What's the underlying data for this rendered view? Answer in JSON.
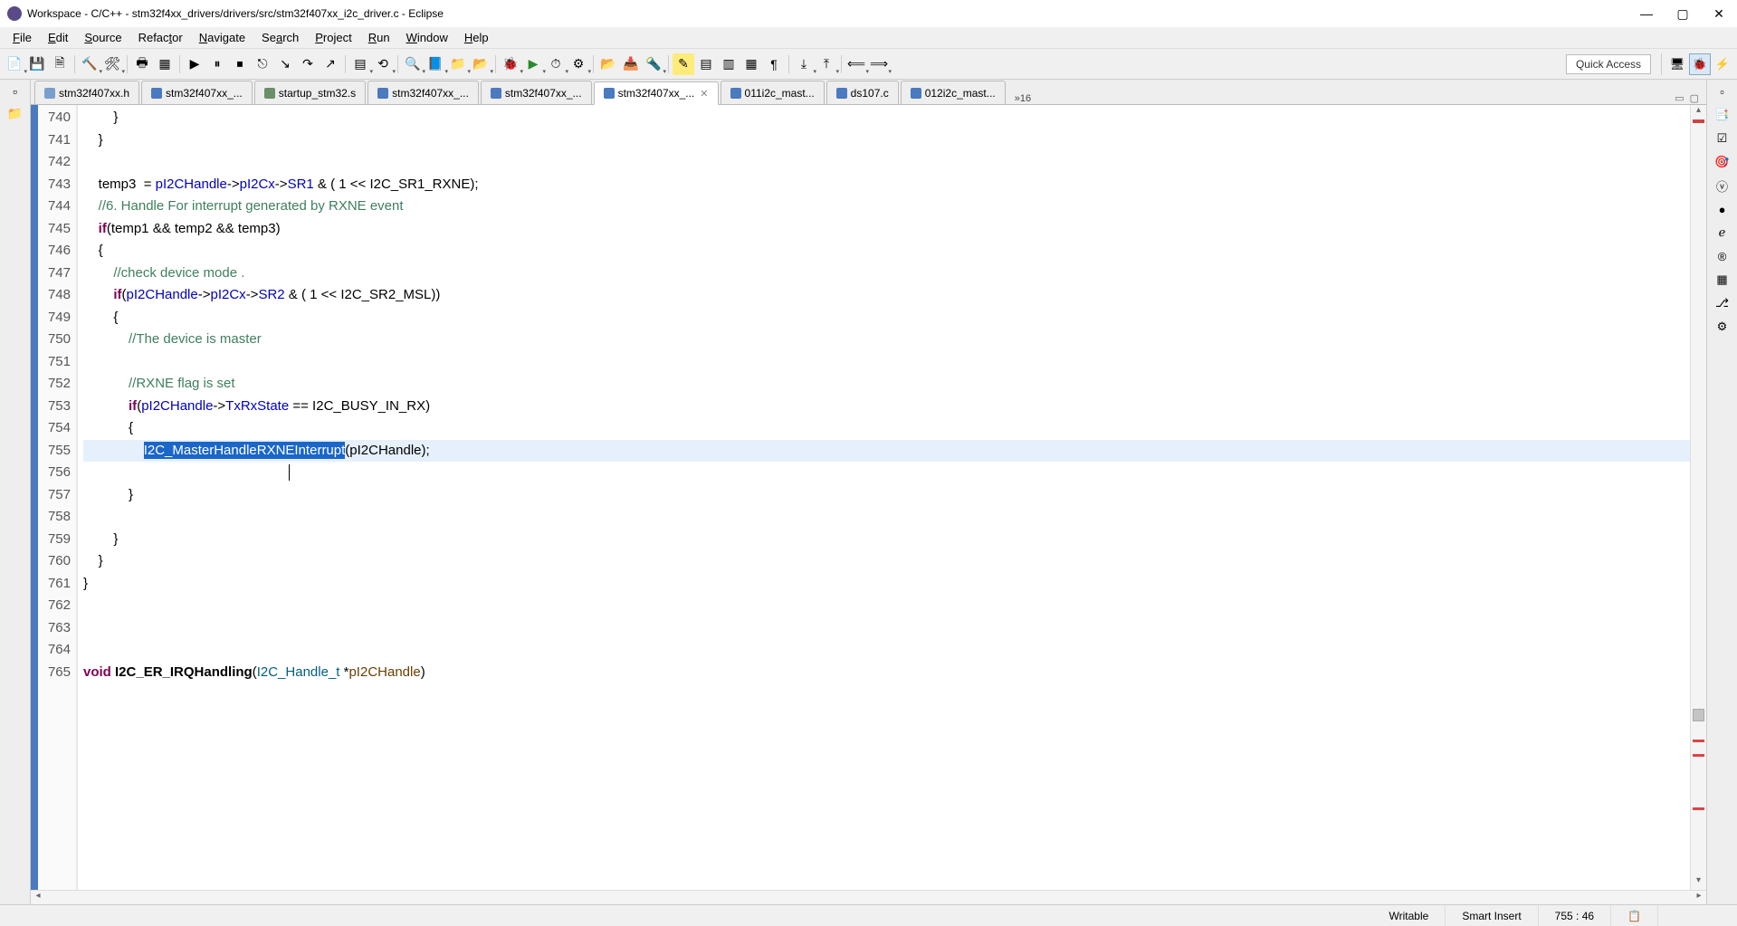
{
  "window": {
    "title": "Workspace - C/C++ - stm32f4xx_drivers/drivers/src/stm32f407xx_i2c_driver.c - Eclipse"
  },
  "menu": {
    "file": "File",
    "edit": "Edit",
    "source": "Source",
    "refactor": "Refactor",
    "navigate": "Navigate",
    "search": "Search",
    "project": "Project",
    "run": "Run",
    "window": "Window",
    "help": "Help"
  },
  "toolbar": {
    "quick_access": "Quick Access"
  },
  "tabs": {
    "items": [
      {
        "label": "stm32f407xx.h",
        "kind": "h"
      },
      {
        "label": "stm32f407xx_...",
        "kind": "c"
      },
      {
        "label": "startup_stm32.s",
        "kind": "s"
      },
      {
        "label": "stm32f407xx_...",
        "kind": "c"
      },
      {
        "label": "stm32f407xx_...",
        "kind": "c"
      },
      {
        "label": "stm32f407xx_...",
        "kind": "c",
        "active": true
      },
      {
        "label": "011i2c_mast...",
        "kind": "c"
      },
      {
        "label": "ds107.c",
        "kind": "c"
      },
      {
        "label": "012i2c_mast...",
        "kind": "c"
      }
    ],
    "overflow": "»16"
  },
  "status": {
    "writable": "Writable",
    "insert": "Smart Insert",
    "position": "755 : 46"
  },
  "code": {
    "first_line": 740,
    "lines": [
      {
        "n": 740,
        "html": "        }"
      },
      {
        "n": 741,
        "html": "    }"
      },
      {
        "n": 742,
        "html": ""
      },
      {
        "n": 743,
        "html": "    temp3  = <span class='field'>pI2CHandle</span>-&gt;<span class='str-const'>pI2Cx</span>-&gt;<span class='str-const'>SR1</span> &amp; ( 1 &lt;&lt; I2C_SR1_RXNE);"
      },
      {
        "n": 744,
        "html": "    <span class='comment'>//6. Handle For interrupt generated by RXNE event</span>"
      },
      {
        "n": 745,
        "html": "    <span class='kw'>if</span>(temp1 &amp;&amp; temp2 &amp;&amp; temp3)"
      },
      {
        "n": 746,
        "html": "    {"
      },
      {
        "n": 747,
        "html": "        <span class='comment'>//check device mode .</span>"
      },
      {
        "n": 748,
        "html": "        <span class='kw'>if</span>(<span class='field'>pI2CHandle</span>-&gt;<span class='str-const'>pI2Cx</span>-&gt;<span class='str-const'>SR2</span> &amp; ( 1 &lt;&lt; I2C_SR2_MSL))"
      },
      {
        "n": 749,
        "html": "        {"
      },
      {
        "n": 750,
        "html": "            <span class='comment'>//The device is master</span>"
      },
      {
        "n": 751,
        "html": ""
      },
      {
        "n": 752,
        "html": "            <span class='comment'>//RXNE flag is set</span>"
      },
      {
        "n": 753,
        "html": "            <span class='kw'>if</span>(<span class='field'>pI2CHandle</span>-&gt;<span class='str-const'>TxRxState</span> == I2C_BUSY_IN_RX)"
      },
      {
        "n": 754,
        "html": "            {"
      },
      {
        "n": 755,
        "html": "                <span class='sel-func'>I2C_MasterHandleRXNEInterrupt</span>(pI2CHandle);",
        "current": true
      },
      {
        "n": 756,
        "html": ""
      },
      {
        "n": 757,
        "html": "            }"
      },
      {
        "n": 758,
        "html": ""
      },
      {
        "n": 759,
        "html": "        }"
      },
      {
        "n": 760,
        "html": "    }"
      },
      {
        "n": 761,
        "html": "}"
      },
      {
        "n": 762,
        "html": ""
      },
      {
        "n": 763,
        "html": ""
      },
      {
        "n": 764,
        "html": ""
      },
      {
        "n": 765,
        "html": "<span class='kw'>void</span> <span class='func'>I2C_ER_IRQHandling</span>(<span class='type-hl'>I2C_Handle_t</span> *<span class='param'>pI2CHandle</span>)"
      }
    ]
  }
}
